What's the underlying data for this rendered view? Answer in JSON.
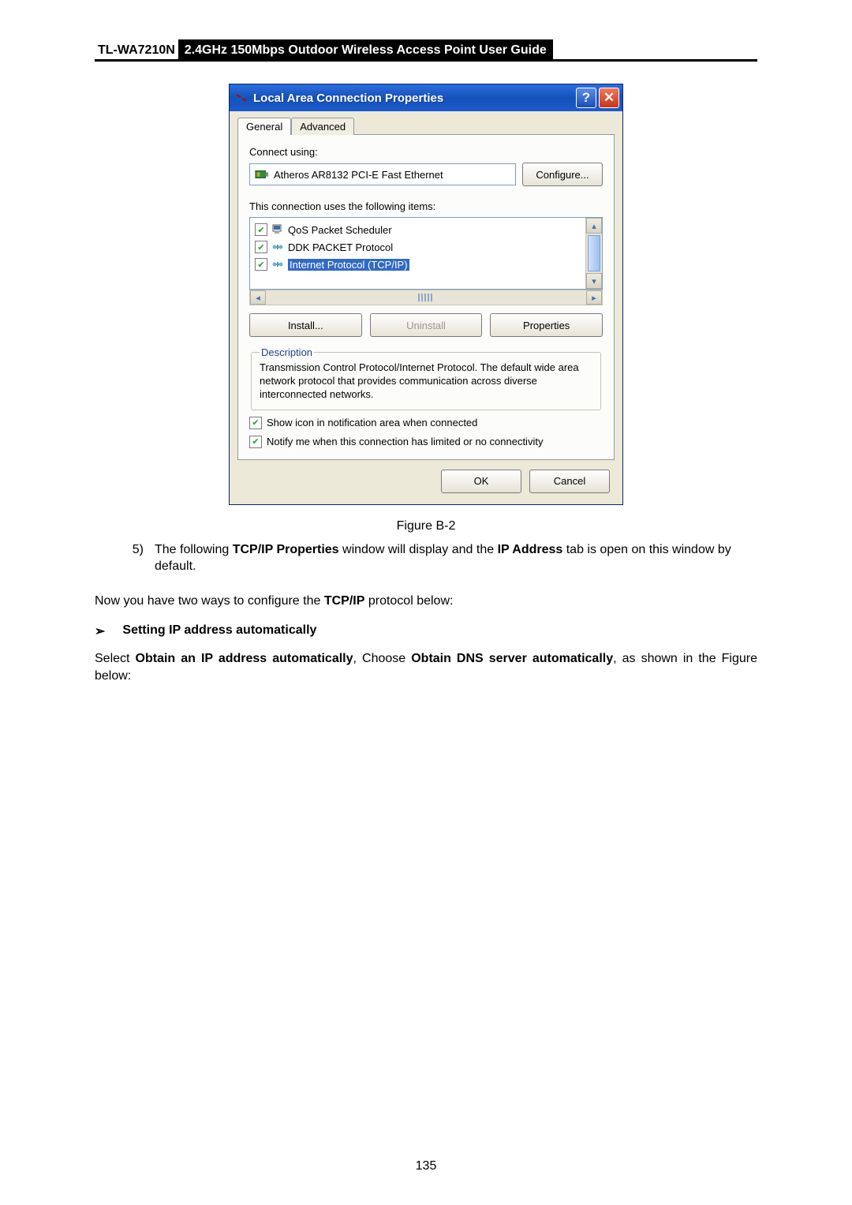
{
  "header": {
    "model": "TL-WA7210N",
    "title": "2.4GHz 150Mbps Outdoor Wireless Access Point User Guide"
  },
  "dialog": {
    "title": "Local Area Connection Properties",
    "tabs": {
      "general": "General",
      "advanced": "Advanced"
    },
    "connect_using_label": "Connect using:",
    "adapter_name": "Atheros AR8132 PCI-E Fast Ethernet",
    "configure_btn": "Configure...",
    "items_label": "This connection uses the following items:",
    "items": [
      {
        "label": "QoS Packet Scheduler",
        "checked": true,
        "icon": "sched"
      },
      {
        "label": "DDK PACKET Protocol",
        "checked": true,
        "icon": "proto"
      },
      {
        "label": "Internet Protocol (TCP/IP)",
        "checked": true,
        "icon": "proto",
        "selected": true
      }
    ],
    "install_btn": "Install...",
    "uninstall_btn": "Uninstall",
    "properties_btn": "Properties",
    "description_legend": "Description",
    "description_text": "Transmission Control Protocol/Internet Protocol. The default wide area network protocol that provides communication across diverse interconnected networks.",
    "show_icon_chk": "Show icon in notification area when connected",
    "notify_chk": "Notify me when this connection has limited or no connectivity",
    "ok_btn": "OK",
    "cancel_btn": "Cancel"
  },
  "figure_caption": "Figure B-2",
  "step5": {
    "num": "5)",
    "pre": "The following ",
    "b1": "TCP/IP Properties",
    "mid": " window will display and the ",
    "b2": "IP Address",
    "post": " tab is open on this window by default."
  },
  "para1": {
    "pre": "Now you have two ways to configure the ",
    "bold": "TCP/IP",
    "post": " protocol below:"
  },
  "bullet1": "Setting IP address automatically",
  "para2": {
    "pre": "Select ",
    "b1": "Obtain an IP address automatically",
    "mid1": ", Choose ",
    "b2": "Obtain DNS server automatically",
    "post": ", as shown in the Figure below:"
  },
  "page_number": "135"
}
